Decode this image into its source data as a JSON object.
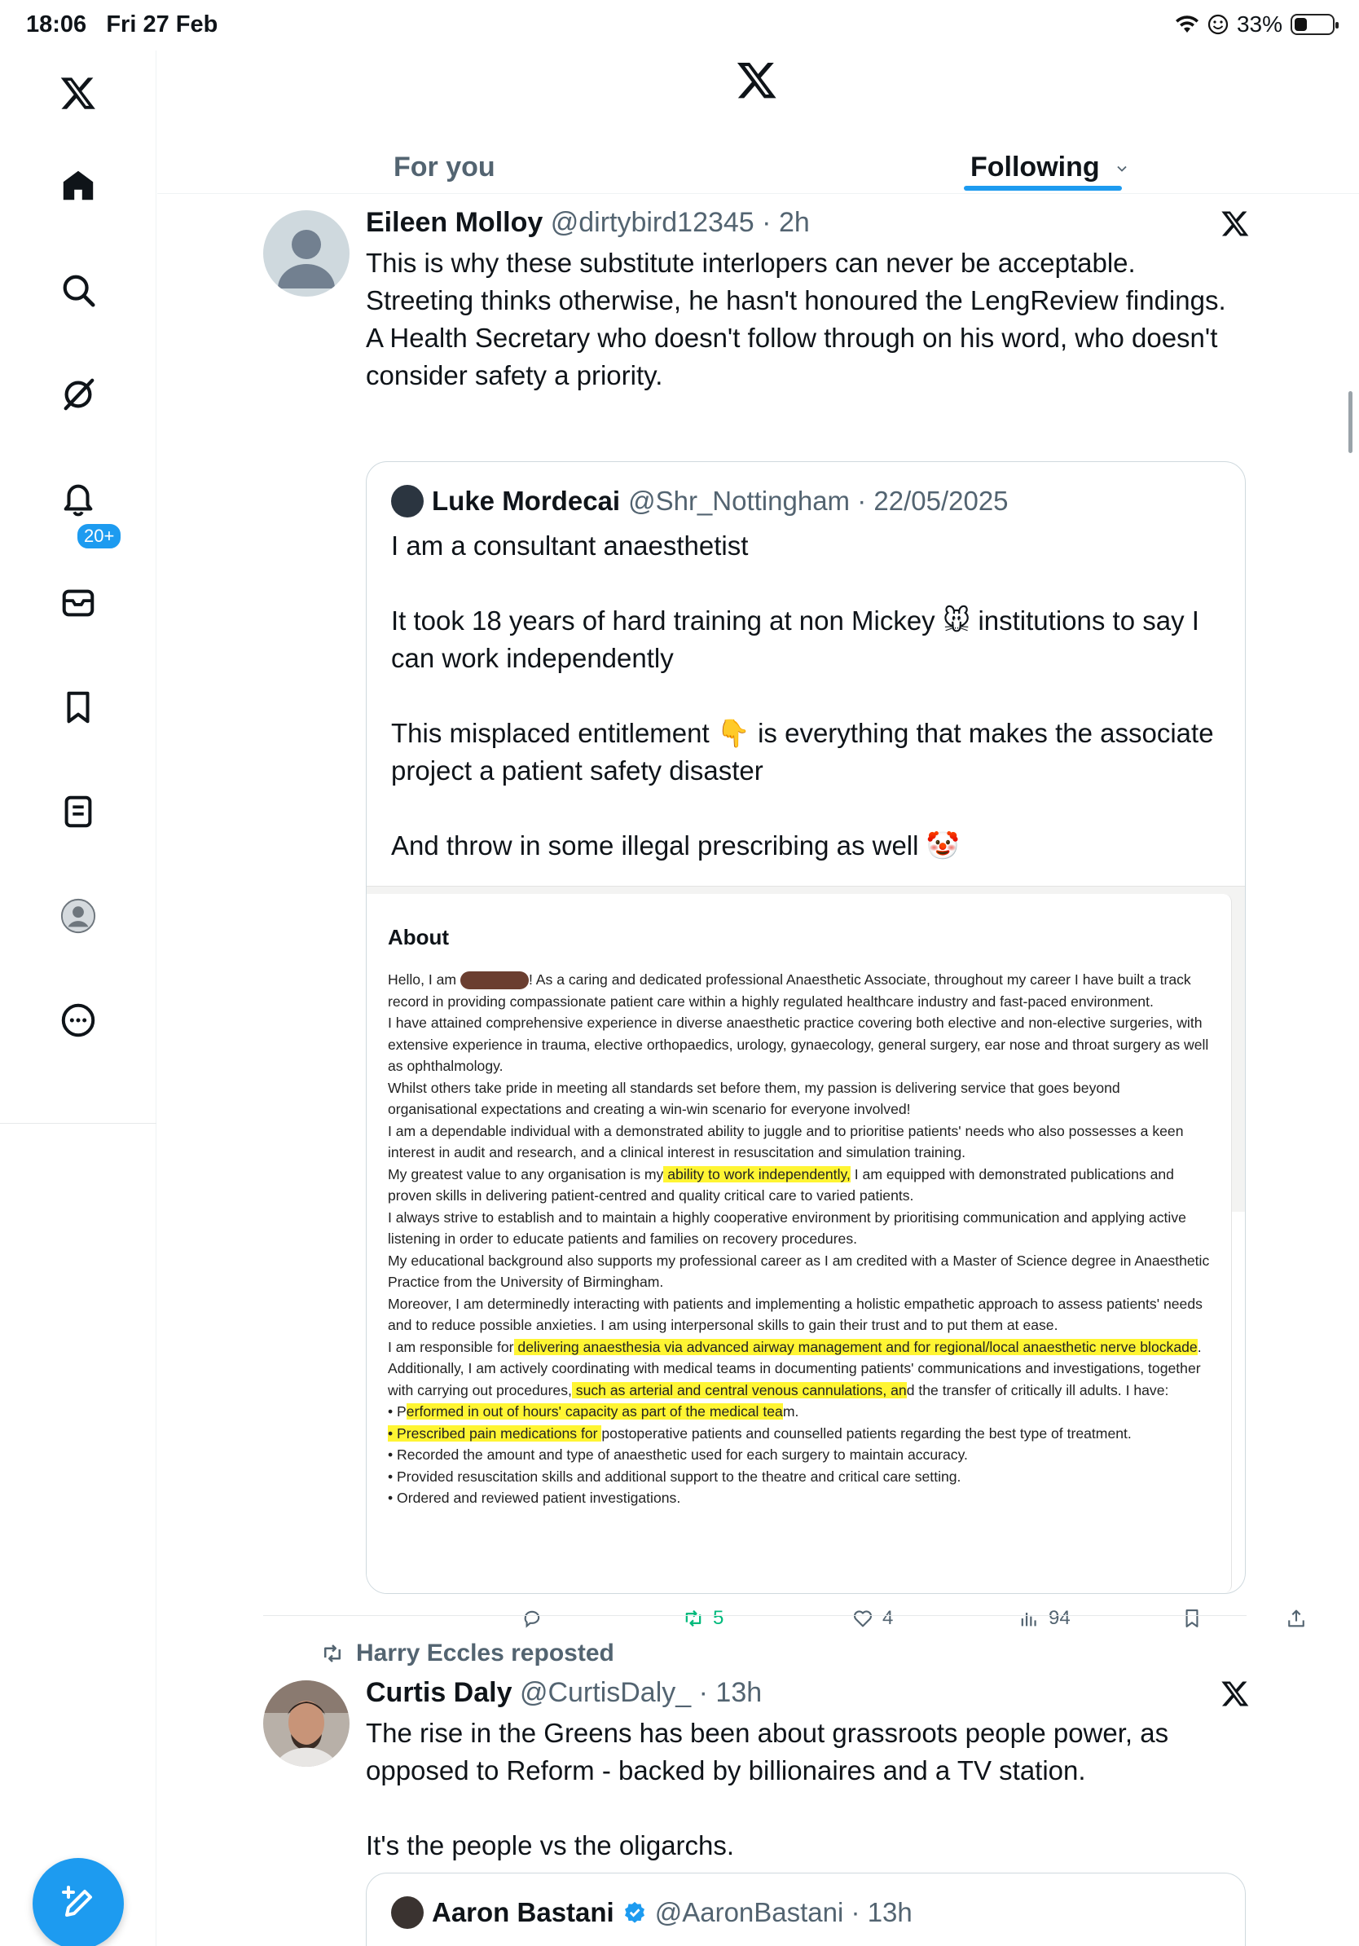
{
  "status": {
    "time": "18:06",
    "date": "Fri 27 Feb",
    "battery": "33%",
    "battery_level": 0.33
  },
  "sidebar": {
    "items": [
      "x-logo",
      "home",
      "explore",
      "grok",
      "notifications",
      "messages",
      "bookmarks",
      "lists",
      "profile",
      "more"
    ],
    "notification_badge": "20+"
  },
  "tabs": {
    "for_you": "For you",
    "following": "Following"
  },
  "tweet1": {
    "name": "Eileen Molloy",
    "handle": "@dirtybird12345",
    "time": "2h",
    "text": "This is why these substitute interlopers can never be acceptable. Streeting thinks otherwise, he hasn't honoured the LengReview findings. A Health Secretary who doesn't follow through on his word, who doesn't consider safety a priority.",
    "quote": {
      "name": "Luke Mordecai",
      "handle": "@Shr_Nottingham",
      "date": "22/05/2025",
      "lines": [
        "I am a consultant anaesthetist",
        "",
        "It took 18 years of hard training at non Mickey 🐭 institutions to say I can work independently",
        "",
        "This misplaced entitlement 👇 is everything that makes the associate project a patient safety disaster",
        "",
        "And throw in some illegal prescribing as well 🤡"
      ],
      "image": {
        "title": "About",
        "p1_a": "Hello, I am",
        "p1_b": "! As a caring and dedicated professional Anaesthetic Associate, throughout my career I have built a track record in providing compassionate patient care within a highly regulated healthcare industry and fast-paced environment.",
        "p2": "I have attained comprehensive experience in diverse anaesthetic practice covering both elective and non-elective surgeries, with extensive experience in trauma, elective orthopaedics, urology, gynaecology, general surgery, ear nose and throat surgery as well as ophthalmology.",
        "p3": "Whilst others take pride in meeting all standards set before them, my passion is delivering service that goes beyond organisational expectations and creating a win-win scenario for everyone involved!",
        "p4": "I am a dependable individual with a demonstrated ability to juggle and to prioritise patients' needs who also possesses a keen interest in audit and research, and a clinical interest in resuscitation and simulation training.",
        "p5_a": "My greatest value to any organisation is my",
        "p5_hl": " ability to work independently,",
        "p5_b": " I am equipped with demonstrated publications and proven skills in delivering patient-centred and quality critical care to varied patients.",
        "p6": "I always strive to establish and to maintain a highly cooperative environment by prioritising communication and applying active listening in order to educate patients and families on recovery procedures.",
        "p7": "My educational background also supports my professional career as I am credited with a Master of Science degree in Anaesthetic Practice from the University of Birmingham.",
        "p8": "Moreover, I am determinedly interacting with patients and implementing a holistic empathetic approach to assess patients' needs and to reduce possible anxieties. I am using interpersonal skills to gain their trust and to put them at ease.",
        "p9_a": "I am responsible for",
        "p9_hl1": " delivering anaesthesia via advanced airway management and for regional/local anaesthetic nerve blockade",
        "p9_b": ". Additionally, I am actively coordinating with medical teams in documenting patients' communications and investigations, together with carrying out procedures,",
        "p9_hl2": " such as arterial and central venous cannulations, an",
        "p9_c": "d the transfer of critically ill adults. I have:",
        "b1_a": "• P",
        "b1_hl": "erformed in out of hours' capacity as part of the medical tea",
        "b1_b": "m.",
        "b2_hl": "• Prescribed pain medications for ",
        "b2_b": "postoperative patients and counselled patients regarding the best type of treatment.",
        "b3": "• Recorded the amount and type of anaesthetic used for each surgery to maintain accuracy.",
        "b4": "• Provided resuscitation skills and additional support to the theatre and critical care setting.",
        "b5": "• Ordered and reviewed patient investigations."
      }
    },
    "stats": {
      "replies": "",
      "reposts": "5",
      "likes": "4",
      "views": "94"
    }
  },
  "tweet2": {
    "reposted_by": "Harry Eccles reposted",
    "name": "Curtis Daly",
    "handle": "@CurtisDaly_",
    "time": "13h",
    "text_lines": [
      "The rise in the Greens has been about grassroots people power, as opposed to Reform - backed by billionaires and a TV station.",
      "",
      "It's the people vs the oligarchs."
    ],
    "quote": {
      "name": "Aaron Bastani",
      "handle": "@AaronBastani",
      "time": "13h",
      "verified": true
    }
  },
  "colors": {
    "accent": "#1d9bf0",
    "text": "#0f1419",
    "muted": "#536471",
    "repost": "#00ba7c",
    "highlight": "#fff533"
  }
}
